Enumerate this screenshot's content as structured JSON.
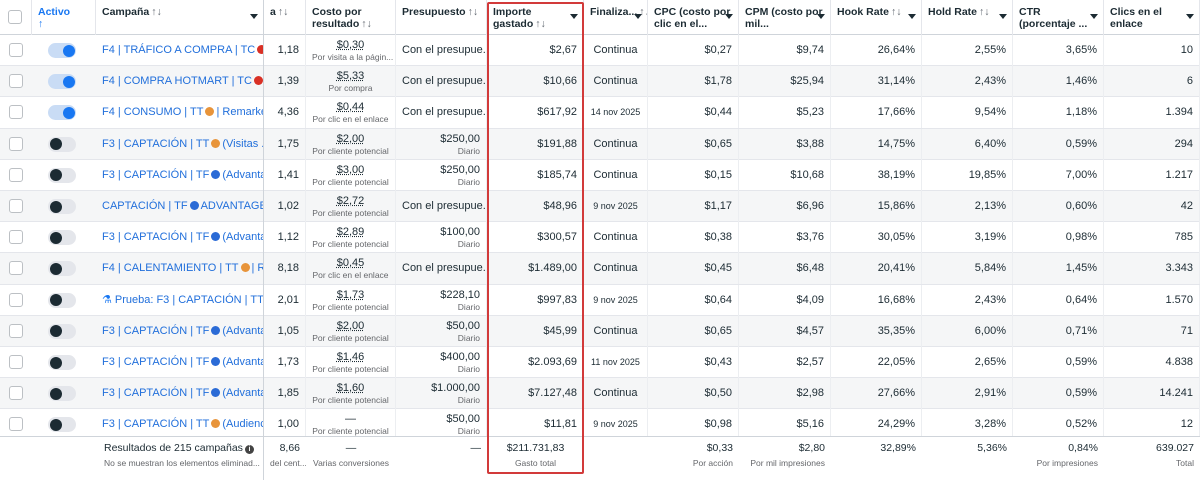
{
  "columns": [
    {
      "key": "check",
      "label": ""
    },
    {
      "key": "active",
      "label": "Activo",
      "sort": "↑"
    },
    {
      "key": "campaign",
      "label": "Campaña",
      "sort": "↑↓"
    },
    {
      "key": "results",
      "label": "a",
      "sort": "↑↓"
    },
    {
      "key": "cpr",
      "label": "Costo por resultado",
      "sort": "↑↓"
    },
    {
      "key": "budget",
      "label": "Presupuesto",
      "sort": "↑↓"
    },
    {
      "key": "spent",
      "label": "Importe gastado",
      "sort": "↑↓"
    },
    {
      "key": "end",
      "label": "Finaliza...",
      "sort": "↑↓"
    },
    {
      "key": "cpc",
      "label": "CPC (costo por clic en el..."
    },
    {
      "key": "cpm",
      "label": "CPM (costo por mil..."
    },
    {
      "key": "hook",
      "label": "Hook Rate",
      "sort": "↑↓"
    },
    {
      "key": "hold",
      "label": "Hold Rate",
      "sort": "↑↓"
    },
    {
      "key": "ctr",
      "label": "CTR (porcentaje ..."
    },
    {
      "key": "clicks",
      "label": "Clics en el enlace"
    }
  ],
  "rows": [
    {
      "on": true,
      "emoji": "red",
      "flask": false,
      "name": "F4 | TRÁFICO A COMPRA | TC",
      "name_tail": "",
      "results": "1,18",
      "cpr": "$0,30",
      "cpr_sub": "Por visita a la págin...",
      "budget": "Con el presupue...",
      "budget_sub": "",
      "spent": "$2,67",
      "end": "Continua",
      "cpc": "$0,27",
      "cpm": "$9,74",
      "hook": "26,64%",
      "hold": "2,55%",
      "ctr": "3,65%",
      "clicks": "10"
    },
    {
      "on": true,
      "emoji": "red",
      "flask": false,
      "name": "F4 | COMPRA HOTMART | TC",
      "name_tail": "",
      "results": "1,39",
      "cpr": "$5,33",
      "cpr_sub": "Por compra",
      "budget": "Con el presupue...",
      "budget_sub": "",
      "spent": "$10,66",
      "end": "Continua",
      "cpc": "$1,78",
      "cpm": "$25,94",
      "hook": "31,14%",
      "hold": "2,43%",
      "ctr": "1,46%",
      "clicks": "6"
    },
    {
      "on": true,
      "emoji": "orange",
      "flask": false,
      "name": "F4 | CONSUMO | TT",
      "name_tail": "| Remarke...",
      "results": "4,36",
      "cpr": "$0,44",
      "cpr_sub": "Por clic en el enlace",
      "budget": "Con el presupue...",
      "budget_sub": "",
      "spent": "$617,92",
      "end": "14 nov 2025",
      "cpc": "$0,44",
      "cpm": "$5,23",
      "hook": "17,66%",
      "hold": "9,54%",
      "ctr": "1,18%",
      "clicks": "1.394"
    },
    {
      "on": false,
      "emoji": "orange",
      "flask": false,
      "name": "F3 | CAPTACIÓN | TT",
      "name_tail": "(Visitas ...",
      "results": "1,75",
      "cpr": "$2,00",
      "cpr_sub": "Por cliente potencial",
      "budget": "$250,00",
      "budget_sub": "Diario",
      "spent": "$191,88",
      "end": "Continua",
      "cpc": "$0,65",
      "cpm": "$3,88",
      "hook": "14,75%",
      "hold": "6,40%",
      "ctr": "0,59%",
      "clicks": "294"
    },
    {
      "on": false,
      "emoji": "blue",
      "flask": false,
      "name": "F3 | CAPTACIÓN | TF",
      "name_tail": "(Advanta...",
      "results": "1,41",
      "cpr": "$3,00",
      "cpr_sub": "Por cliente potencial",
      "budget": "$250,00",
      "budget_sub": "Diario",
      "spent": "$185,74",
      "end": "Continua",
      "cpc": "$0,15",
      "cpm": "$10,68",
      "hook": "38,19%",
      "hold": "19,85%",
      "ctr": "7,00%",
      "clicks": "1.217"
    },
    {
      "on": false,
      "emoji": "blue",
      "flask": false,
      "name": "CAPTACIÓN | TF",
      "name_tail": "ADVANTAGE...",
      "results": "1,02",
      "cpr": "$2,72",
      "cpr_sub": "Por cliente potencial",
      "budget": "Con el presupue...",
      "budget_sub": "",
      "spent": "$48,96",
      "end": "9 nov 2025",
      "cpc": "$1,17",
      "cpm": "$6,96",
      "hook": "15,86%",
      "hold": "2,13%",
      "ctr": "0,60%",
      "clicks": "42"
    },
    {
      "on": false,
      "emoji": "blue",
      "flask": false,
      "name": "F3 | CAPTACIÓN | TF",
      "name_tail": "(Advanta...",
      "results": "1,12",
      "cpr": "$2,89",
      "cpr_sub": "Por cliente potencial",
      "budget": "$100,00",
      "budget_sub": "Diario",
      "spent": "$300,57",
      "end": "Continua",
      "cpc": "$0,38",
      "cpm": "$3,76",
      "hook": "30,05%",
      "hold": "3,19%",
      "ctr": "0,98%",
      "clicks": "785"
    },
    {
      "on": false,
      "emoji": "orange",
      "flask": false,
      "name": "F4 | CALENTAMIENTO | TT",
      "name_tail": "| R...",
      "results": "8,18",
      "cpr": "$0,45",
      "cpr_sub": "Por clic en el enlace",
      "budget": "Con el presupue...",
      "budget_sub": "",
      "spent": "$1.489,00",
      "end": "Continua",
      "cpc": "$0,45",
      "cpm": "$6,48",
      "hook": "20,41%",
      "hold": "5,84%",
      "ctr": "1,45%",
      "clicks": "3.343"
    },
    {
      "on": false,
      "emoji": "orange",
      "flask": true,
      "name": "Prueba: F3 | CAPTACIÓN | TT",
      "name_tail": "",
      "results": "2,01",
      "cpr": "$1,73",
      "cpr_sub": "Por cliente potencial",
      "budget": "$228,10",
      "budget_sub": "Diario",
      "spent": "$997,83",
      "end": "9 nov 2025",
      "cpc": "$0,64",
      "cpm": "$4,09",
      "hook": "16,68%",
      "hold": "2,43%",
      "ctr": "0,64%",
      "clicks": "1.570"
    },
    {
      "on": false,
      "emoji": "blue",
      "flask": false,
      "name": "F3 | CAPTACIÓN | TF",
      "name_tail": "(Advanta...",
      "results": "1,05",
      "cpr": "$2,00",
      "cpr_sub": "Por cliente potencial",
      "budget": "$50,00",
      "budget_sub": "Diario",
      "spent": "$45,99",
      "end": "Continua",
      "cpc": "$0,65",
      "cpm": "$4,57",
      "hook": "35,35%",
      "hold": "6,00%",
      "ctr": "0,71%",
      "clicks": "71"
    },
    {
      "on": false,
      "emoji": "blue",
      "flask": false,
      "name": "F3 | CAPTACIÓN | TF",
      "name_tail": "(Advanta...",
      "results": "1,73",
      "cpr": "$1,46",
      "cpr_sub": "Por cliente potencial",
      "budget": "$400,00",
      "budget_sub": "Diario",
      "spent": "$2.093,69",
      "end": "11 nov 2025",
      "cpc": "$0,43",
      "cpm": "$2,57",
      "hook": "22,05%",
      "hold": "2,65%",
      "ctr": "0,59%",
      "clicks": "4.838"
    },
    {
      "on": false,
      "emoji": "blue",
      "flask": false,
      "name": "F3 | CAPTACIÓN | TF",
      "name_tail": "(Advanta...",
      "results": "1,85",
      "cpr": "$1,60",
      "cpr_sub": "Por cliente potencial",
      "budget": "$1.000,00",
      "budget_sub": "Diario",
      "spent": "$7.127,48",
      "end": "Continua",
      "cpc": "$0,50",
      "cpm": "$2,98",
      "hook": "27,66%",
      "hold": "2,91%",
      "ctr": "0,59%",
      "clicks": "14.241"
    },
    {
      "on": false,
      "emoji": "orange",
      "flask": false,
      "name": "F3 | CAPTACIÓN | TT",
      "name_tail": "(Audienc...",
      "results": "1,00",
      "cpr": "—",
      "cpr_sub": "Por cliente potencial",
      "budget": "$50,00",
      "budget_sub": "Diario",
      "spent": "$11,81",
      "end": "9 nov 2025",
      "cpc": "$0,98",
      "cpm": "$5,16",
      "hook": "24,29%",
      "hold": "3,28%",
      "ctr": "0,52%",
      "clicks": "12"
    }
  ],
  "footer": {
    "title": "Resultados de 215 campañas",
    "sub": "No se muestran los elementos eliminad...",
    "results": "8,66",
    "results_sub": "del cent...",
    "cpr": "—",
    "cpr_sub": "Varias conversiones",
    "budget": "—",
    "spent": "$211.731,83",
    "spent_sub": "Gasto total",
    "cpc": "$0,33",
    "cpc_sub": "Por acción",
    "cpm": "$2,80",
    "cpm_sub": "Por mil impresiones",
    "hook": "32,89%",
    "hold": "5,36%",
    "ctr": "0,84%",
    "ctr_sub": "Por impresiones",
    "clicks": "639.027",
    "clicks_sub": "Total"
  },
  "colors": {
    "accent": "#1877f2",
    "highlight": "#d23a3a",
    "link": "#216fdb"
  }
}
